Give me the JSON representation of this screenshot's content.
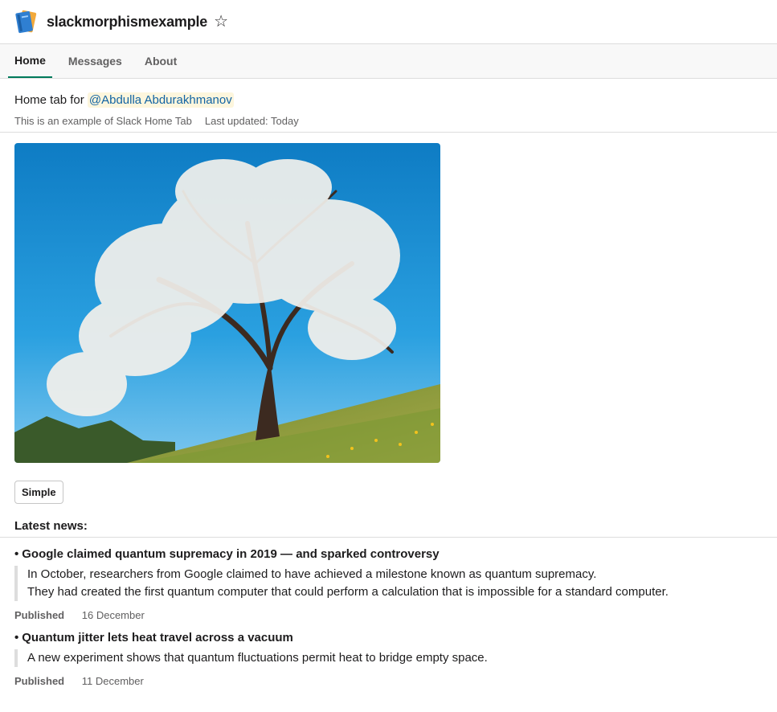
{
  "header": {
    "app_name": "slackmorphismexample"
  },
  "tabs": [
    {
      "label": "Home",
      "active": true
    },
    {
      "label": "Messages",
      "active": false
    },
    {
      "label": "About",
      "active": false
    }
  ],
  "home": {
    "intro_prefix": "Home tab for ",
    "mention": "@Abdulla Abdurakhmanov",
    "context_description": "This is an example of Slack Home Tab",
    "context_updated": "Last updated: Today",
    "button_label": "Simple"
  },
  "news": {
    "title": "Latest news:",
    "articles": [
      {
        "title": "Google claimed quantum supremacy in 2019 — and sparked controversy",
        "body_line1": "In October, researchers from Google claimed to have achieved a milestone known as quantum supremacy.",
        "body_line2": "They had created the first quantum computer that could perform a calculation that is impossible for a standard computer.",
        "published_label": "Published",
        "date": "16 December"
      },
      {
        "title": "Quantum jitter lets heat travel across a vacuum",
        "body_line1": "A new experiment shows that quantum fluctuations permit heat to bridge empty space.",
        "published_label": "Published",
        "date": "11 December"
      }
    ]
  },
  "colors": {
    "accent_tab": "#007a5a",
    "mention_text": "#1264a3",
    "mention_bg": "#fdf6dd",
    "sky": "#1f8fd4",
    "grass": "#8aa33a"
  },
  "icons": {
    "app_icon": "notebook-icon",
    "star": "star-outline-icon"
  }
}
